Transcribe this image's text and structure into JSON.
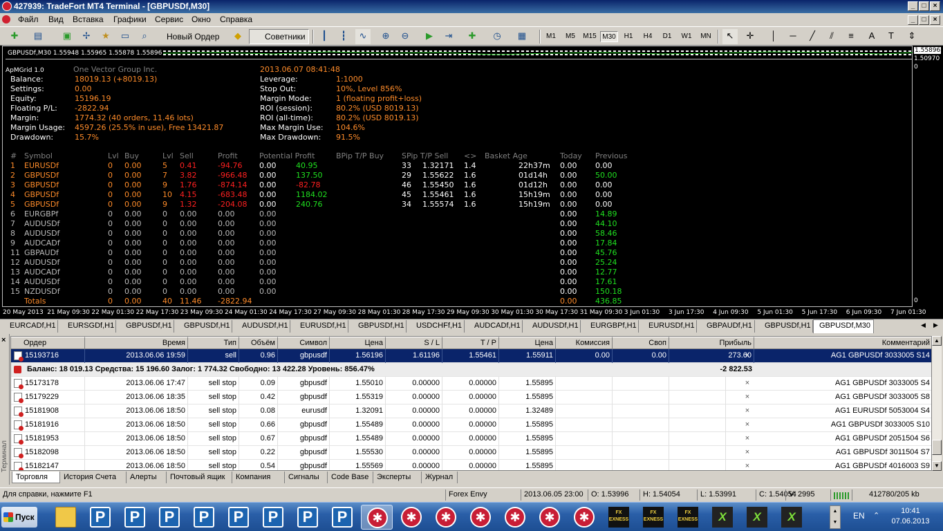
{
  "window": {
    "title": "427939: TradeFort MT4 Terminal - [GBPUSDf,M30]",
    "min": "_",
    "max": "□",
    "close": "×"
  },
  "menu": [
    "Файл",
    "Вид",
    "Вставка",
    "Графики",
    "Сервис",
    "Окно",
    "Справка"
  ],
  "toolbar": {
    "new_order": "Новый Ордер",
    "advisors": "Советники",
    "timeframes": [
      "M1",
      "M5",
      "M15",
      "M30",
      "H1",
      "H4",
      "D1",
      "W1",
      "MN"
    ],
    "active_timeframe": "M30"
  },
  "chart": {
    "symbol_line": "GBPUSDf,M30  1.55948 1.55965 1.55878 1.55896",
    "price_labels": [
      "1.55896",
      "1.50970",
      "0",
      "0"
    ],
    "time_labels": [
      "20 May 2013",
      "21 May 09:30",
      "22 May 01:30",
      "22 May 17:30",
      "23 May 09:30",
      "24 May 01:30",
      "24 May 17:30",
      "27 May 09:30",
      "28 May 01:30",
      "28 May 17:30",
      "29 May 09:30",
      "30 May 01:30",
      "30 May 17:30",
      "31 May 09:30",
      "3 Jun 01:30",
      "3 Jun 17:30",
      "4 Jun 09:30",
      "5 Jun 01:30",
      "5 Jun 17:30",
      "6 Jun 09:30",
      "7 Jun 01:30"
    ],
    "ea_name": "ApMGrid 1.0",
    "company": "One Vector Group Inc.",
    "datetime": "2013.06.07 08:41:48",
    "left_block": [
      {
        "label": "Balance:",
        "value": "18019.13 (+8019.13)"
      },
      {
        "label": "Settings:",
        "value": "0.00"
      },
      {
        "label": "Equity:",
        "value": "15196.19"
      },
      {
        "label": "Floating P/L:",
        "value": "-2822.94"
      },
      {
        "label": "Margin:",
        "value": "1774.32 (40 orders, 11.46 lots)"
      },
      {
        "label": "Margin Usage:",
        "value": "4597.26 (25.5% in use), Free 13421.87"
      },
      {
        "label": "Drawdown:",
        "value": "15.7%"
      }
    ],
    "right_block": [
      {
        "label": "Leverage:",
        "value": "1:1000"
      },
      {
        "label": "Stop Out:",
        "value": "10%, Level 856%"
      },
      {
        "label": "Margin Mode:",
        "value": "1 (floating profit+loss)"
      },
      {
        "label": "ROI (session):",
        "value": "80.2% (USD 8019.13)"
      },
      {
        "label": "ROI (all-time):",
        "value": "80.2% (USD 8019.13)"
      },
      {
        "label": "Max Margin Use:",
        "value": "104.6%"
      },
      {
        "label": "Max Drawdown:",
        "value": "91.5%"
      }
    ],
    "table_headers": [
      "#",
      "Symbol",
      "Lvl",
      "Buy",
      "Lvl",
      "Sell",
      "Profit",
      "Potential Profit",
      "BPip T/P Buy",
      "SPip T/P Sell",
      "<>",
      "Basket Age",
      "Today",
      "Previous"
    ],
    "rows": [
      [
        "1",
        "EURUSDf",
        "0",
        "0.00",
        "5",
        "0.41",
        "-94.76",
        "0.00",
        "40.95",
        "33",
        "1.32171",
        "1.4",
        "22h37m",
        "0.00",
        "0.00"
      ],
      [
        "2",
        "GBPUSDf",
        "0",
        "0.00",
        "7",
        "3.82",
        "-966.48",
        "0.00",
        "137.50",
        "29",
        "1.55622",
        "1.6",
        "01d14h",
        "0.00",
        "50.00"
      ],
      [
        "3",
        "GBPUSDf",
        "0",
        "0.00",
        "9",
        "1.76",
        "-874.14",
        "0.00",
        "-82.78",
        "46",
        "1.55450",
        "1.6",
        "01d12h",
        "0.00",
        "0.00"
      ],
      [
        "4",
        "GBPUSDf",
        "0",
        "0.00",
        "10",
        "4.15",
        "-683.48",
        "0.00",
        "1184.02",
        "45",
        "1.55461",
        "1.6",
        "15h19m",
        "0.00",
        "0.00"
      ],
      [
        "5",
        "GBPUSDf",
        "0",
        "0.00",
        "9",
        "1.32",
        "-204.08",
        "0.00",
        "240.76",
        "34",
        "1.55574",
        "1.6",
        "15h19m",
        "0.00",
        "0.00"
      ],
      [
        "6",
        "EURGBPf",
        "0",
        "0.00",
        "0",
        "0.00",
        "0.00",
        "0.00",
        "",
        "",
        "",
        "",
        "",
        "0.00",
        "14.89"
      ],
      [
        "7",
        "AUDUSDf",
        "0",
        "0.00",
        "0",
        "0.00",
        "0.00",
        "0.00",
        "",
        "",
        "",
        "",
        "",
        "0.00",
        "44.10"
      ],
      [
        "8",
        "AUDUSDf",
        "0",
        "0.00",
        "0",
        "0.00",
        "0.00",
        "0.00",
        "",
        "",
        "",
        "",
        "",
        "0.00",
        "58.46"
      ],
      [
        "9",
        "AUDCADf",
        "0",
        "0.00",
        "0",
        "0.00",
        "0.00",
        "0.00",
        "",
        "",
        "",
        "",
        "",
        "0.00",
        "17.84"
      ],
      [
        "11",
        "GBPAUDf",
        "0",
        "0.00",
        "0",
        "0.00",
        "0.00",
        "0.00",
        "",
        "",
        "",
        "",
        "",
        "0.00",
        "45.76"
      ],
      [
        "12",
        "AUDUSDf",
        "0",
        "0.00",
        "0",
        "0.00",
        "0.00",
        "0.00",
        "",
        "",
        "",
        "",
        "",
        "0.00",
        "25.24"
      ],
      [
        "13",
        "AUDCADf",
        "0",
        "0.00",
        "0",
        "0.00",
        "0.00",
        "0.00",
        "",
        "",
        "",
        "",
        "",
        "0.00",
        "12.77"
      ],
      [
        "14",
        "AUDUSDf",
        "0",
        "0.00",
        "0",
        "0.00",
        "0.00",
        "0.00",
        "",
        "",
        "",
        "",
        "",
        "0.00",
        "17.61"
      ],
      [
        "15",
        "NZDUSDf",
        "0",
        "0.00",
        "0",
        "0.00",
        "0.00",
        "0.00",
        "",
        "",
        "",
        "",
        "",
        "0.00",
        "150.18"
      ]
    ],
    "totals": [
      "Totals",
      "0",
      "0.00",
      "40",
      "11.46",
      "-2822.94",
      "0.00",
      "436.85"
    ]
  },
  "chart_tabs": [
    "EURCADf,H1",
    "EURSGDf,H1",
    "GBPUSDf,H1",
    "GBPUSDf,H1",
    "AUDUSDf,H1",
    "EURUSDf,H1",
    "GBPUSDf,H1",
    "USDCHFf,H1",
    "AUDCADf,H1",
    "AUDUSDf,H1",
    "EURGBPf,H1",
    "EURUSDf,H1",
    "GBPAUDf,H1",
    "GBPUSDf,H1",
    "GBPUSDf,M30"
  ],
  "active_chart_tab": "GBPUSDf,M30",
  "terminal": {
    "side_label": "Терминал",
    "headers": [
      "Ордер",
      "Время",
      "Тип",
      "Объём",
      "Символ",
      "Цена",
      "S / L",
      "T / P",
      "Цена",
      "Комиссия",
      "Своп",
      "Прибыль",
      "Комментарий"
    ],
    "selected_row": [
      "15193716",
      "2013.06.06 19:59",
      "sell",
      "0.96",
      "gbpusdf",
      "1.56196",
      "1.61196",
      "1.55461",
      "1.55911",
      "0.00",
      "0.00",
      "273.60",
      "AG1 GBPUSDf 3033005 S14"
    ],
    "balance_line": "Баланс: 18 019.13  Средства: 15 196.60  Залог: 1 774.32  Свободно: 13 422.28  Уровень: 856.47%",
    "balance_profit": "-2 822.53",
    "orders": [
      [
        "15173178",
        "2013.06.06 17:47",
        "sell stop",
        "0.09",
        "gbpusdf",
        "1.55010",
        "0.00000",
        "0.00000",
        "1.55895",
        "AG1 GBPUSDf 3033005 S4"
      ],
      [
        "15179229",
        "2013.06.06 18:35",
        "sell stop",
        "0.42",
        "gbpusdf",
        "1.55319",
        "0.00000",
        "0.00000",
        "1.55895",
        "AG1 GBPUSDf 3033005 S8"
      ],
      [
        "15181908",
        "2013.06.06 18:50",
        "sell stop",
        "0.08",
        "eurusdf",
        "1.32091",
        "0.00000",
        "0.00000",
        "1.32489",
        "AG1 EURUSDf 5053004 S4"
      ],
      [
        "15181916",
        "2013.06.06 18:50",
        "sell stop",
        "0.66",
        "gbpusdf",
        "1.55489",
        "0.00000",
        "0.00000",
        "1.55895",
        "AG1 GBPUSDf 3033005 S10"
      ],
      [
        "15181953",
        "2013.06.06 18:50",
        "sell stop",
        "0.67",
        "gbpusdf",
        "1.55489",
        "0.00000",
        "0.00000",
        "1.55895",
        "AG1 GBPUSDf 2051504 S6"
      ],
      [
        "15182098",
        "2013.06.06 18:50",
        "sell stop",
        "0.22",
        "gbpusdf",
        "1.55530",
        "0.00000",
        "0.00000",
        "1.55895",
        "AG1 GBPUSDf 3011504 S7"
      ],
      [
        "15182147",
        "2013.06.06 18:50",
        "sell stop",
        "0.54",
        "gbpusdf",
        "1.55569",
        "0.00000",
        "0.00000",
        "1.55895",
        "AG1 GBPUSDf 4016003 S9"
      ]
    ],
    "tabs": [
      "Торговля",
      "История Счета",
      "Алерты",
      "Почтовый ящик",
      "Компания",
      "Сигналы",
      "Code Base",
      "Эксперты",
      "Журнал"
    ],
    "active_tab": "Торговля"
  },
  "status": {
    "help": "Для справки, нажмите F1",
    "profile": "Forex Envy",
    "datetime": "2013.06.05 23:00",
    "open": "O: 1.53996",
    "high": "H: 1.54054",
    "low": "L: 1.53991",
    "close": "C: 1.54054",
    "volume": "V: 2995",
    "traffic": "412780/205 kb"
  },
  "taskbar": {
    "start": "Пуск",
    "lang": "EN",
    "time": "10:41",
    "date": "07.06.2013",
    "exness_label": "EXNESS"
  },
  "colors": {
    "profit_red": "#ff2020",
    "profit_green": "#20e020",
    "value_orange": "#ff8c2a",
    "selected_row": "#0a246a"
  }
}
